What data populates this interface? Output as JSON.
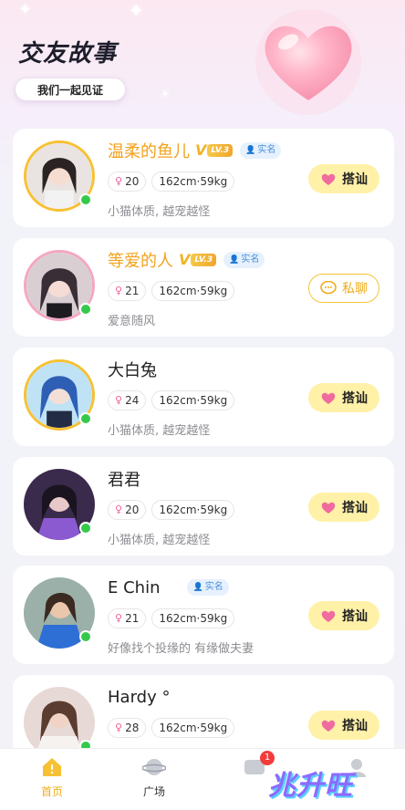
{
  "header": {
    "title": "交友故事",
    "subtitle": "我们一起见证"
  },
  "colors": {
    "accent": "#f2a21c",
    "chat_button_bg": "#fff1a8",
    "online": "#35c94c",
    "realname_text": "#4a8fde"
  },
  "users": [
    {
      "name": "温柔的鱼儿",
      "vip": true,
      "vip_level": "LV.3",
      "realname": "实名",
      "age": "20",
      "size": "162cm·59kg",
      "bio": "小猫体质, 越宠越怪",
      "button": "搭讪",
      "button_style": "filled"
    },
    {
      "name": "等爱的人",
      "vip": true,
      "vip_level": "LV.3",
      "realname": "实名",
      "age": "21",
      "size": "162cm·59kg",
      "bio": "爱意随风",
      "button": "私聊",
      "button_style": "outline"
    },
    {
      "name": "大白兔",
      "vip": false,
      "vip_level": "",
      "realname": "",
      "age": "24",
      "size": "162cm·59kg",
      "bio": "小猫体质, 越宠越怪",
      "button": "搭讪",
      "button_style": "filled"
    },
    {
      "name": "君君",
      "vip": false,
      "vip_level": "",
      "realname": "",
      "age": "20",
      "size": "162cm·59kg",
      "bio": "小猫体质, 越宠越怪",
      "button": "搭讪",
      "button_style": "filled"
    },
    {
      "name": "E Chin",
      "vip": false,
      "vip_level": "",
      "realname": "实名",
      "age": "21",
      "size": "162cm·59kg",
      "bio": "好像找个投缘的 有缘做夫妻",
      "button": "搭讪",
      "button_style": "filled"
    },
    {
      "name": "Hardy °",
      "vip": false,
      "vip_level": "",
      "realname": "",
      "age": "28",
      "size": "162cm·59kg",
      "bio": "",
      "button": "搭讪",
      "button_style": "filled"
    }
  ],
  "tabbar": {
    "home_label": "首页",
    "plaza_label": "广场",
    "message_badge": "1"
  },
  "watermark": "兆升旺"
}
